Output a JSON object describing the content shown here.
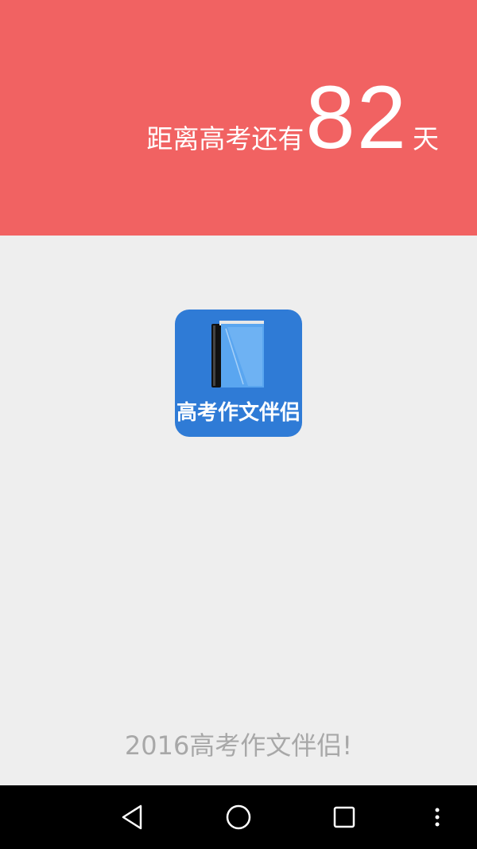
{
  "countdown": {
    "prefix": "距离高考还有",
    "days": "82",
    "suffix": "天"
  },
  "logo": {
    "text": "高考作文伴侣",
    "background_color": "#2f7bd6",
    "icon": "book-icon"
  },
  "slogan": "2016高考作文伴侣!",
  "navbar": {
    "back_icon": "back-triangle-icon",
    "home_icon": "home-circle-icon",
    "recents_icon": "recents-square-icon",
    "menu_icon": "overflow-menu-icon"
  },
  "colors": {
    "header": "#f16262",
    "body": "#eeeeee",
    "slogan_text": "#a8a8a8"
  }
}
